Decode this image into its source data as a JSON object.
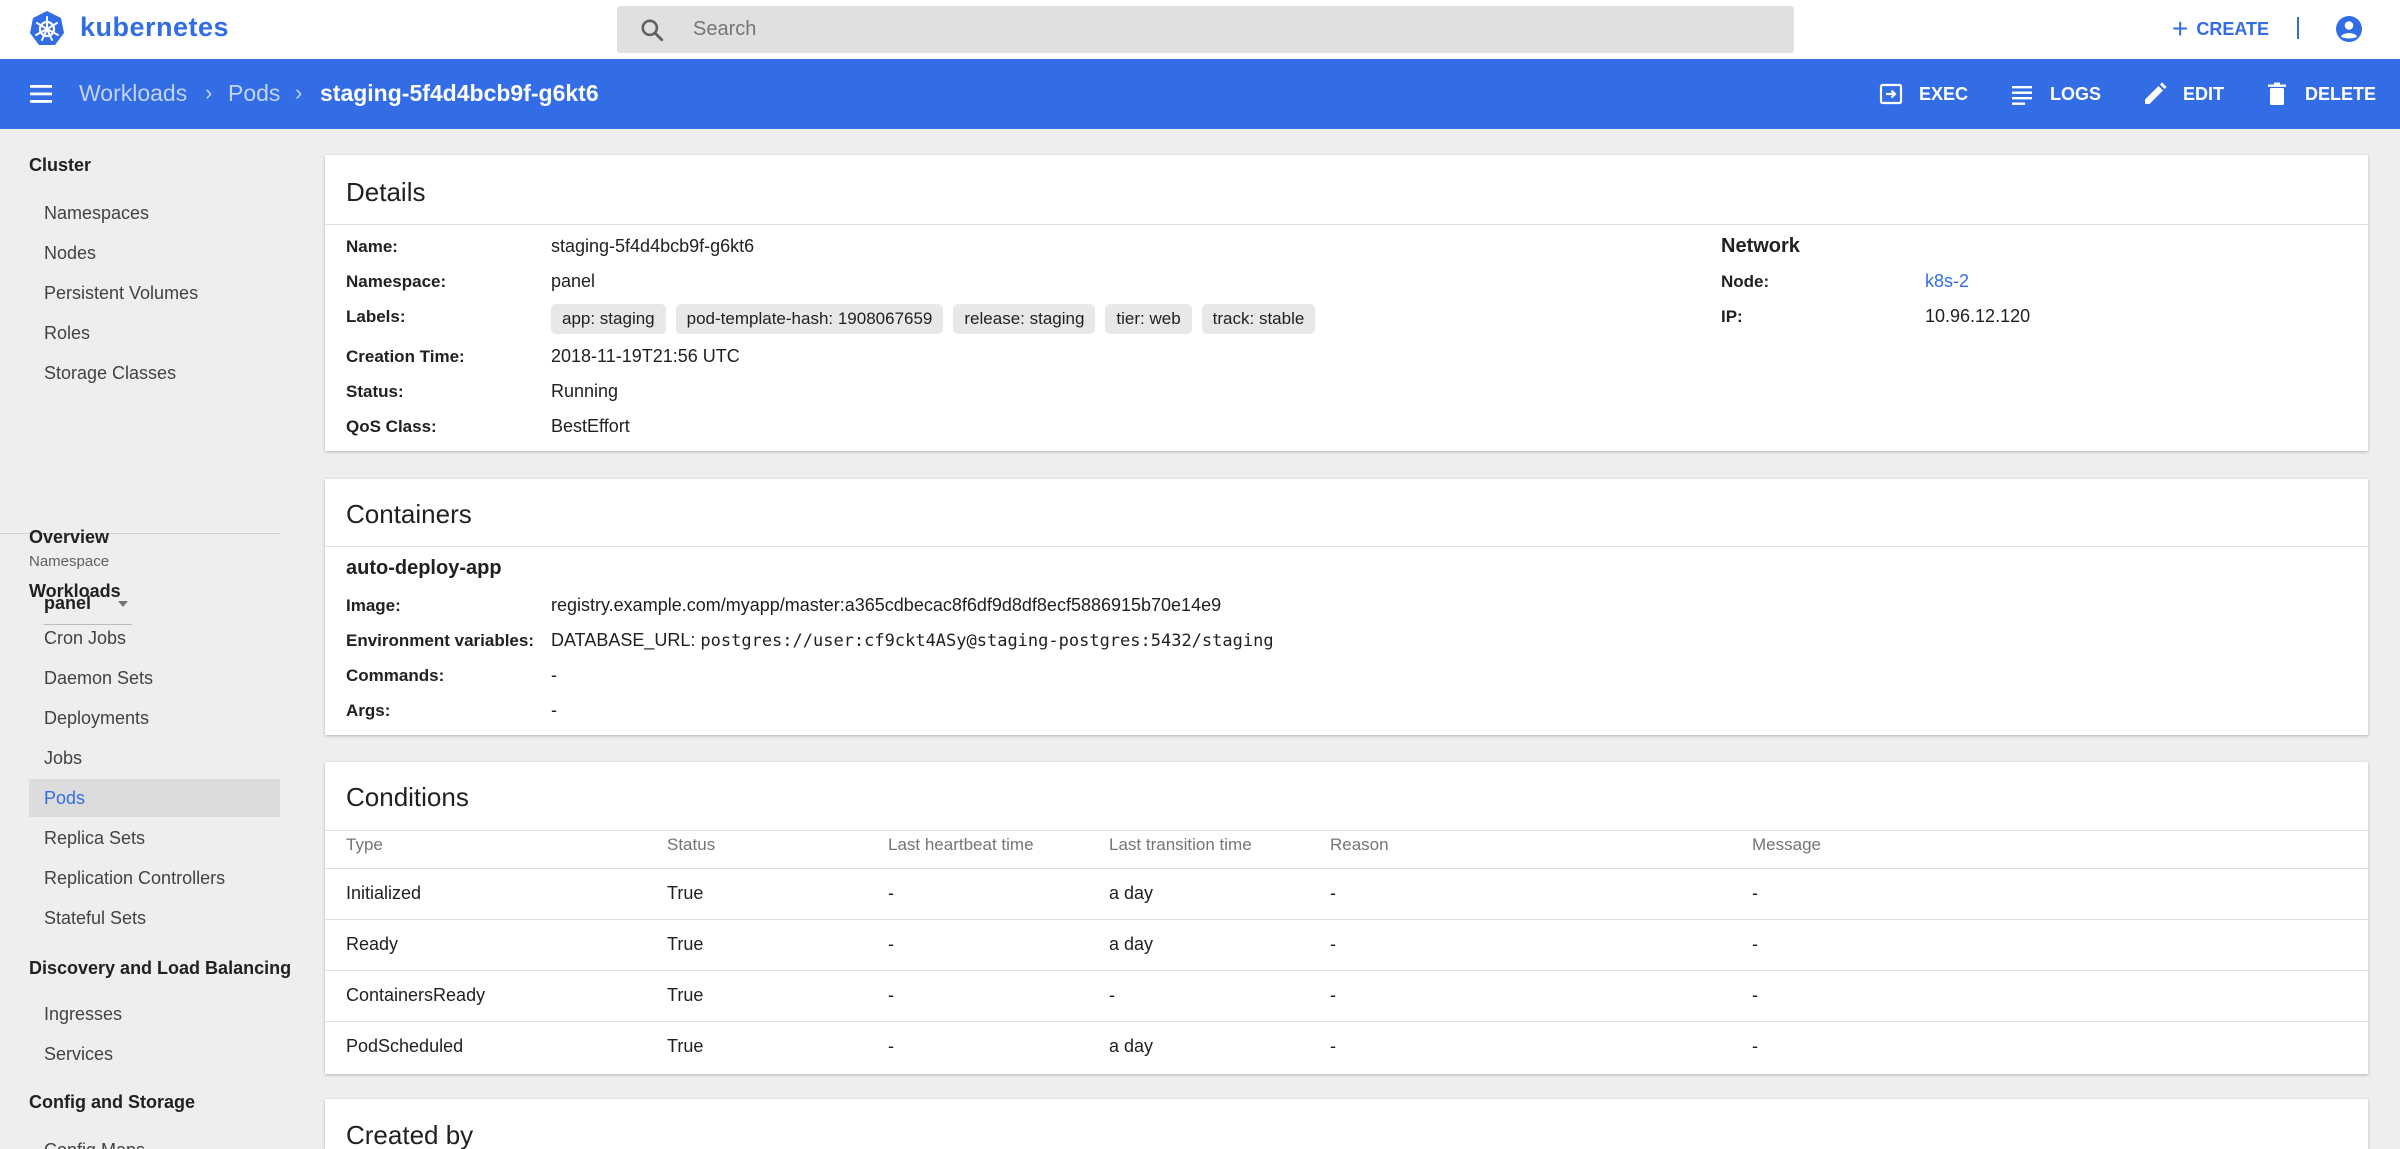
{
  "brand": {
    "name": "kubernetes"
  },
  "search": {
    "placeholder": "Search"
  },
  "topbar": {
    "create_label": "CREATE"
  },
  "breadcrumb": {
    "items": [
      "Workloads",
      "Pods"
    ],
    "current": "staging-5f4d4bcb9f-g6kt6"
  },
  "actions": {
    "exec": "EXEC",
    "logs": "LOGS",
    "edit": "EDIT",
    "delete": "DELETE"
  },
  "sidebar": {
    "cluster": {
      "title": "Cluster",
      "items": [
        "Namespaces",
        "Nodes",
        "Persistent Volumes",
        "Roles",
        "Storage Classes"
      ]
    },
    "namespace": {
      "label": "Namespace",
      "value": "panel"
    },
    "overview": "Overview",
    "workloads": {
      "title": "Workloads",
      "items": [
        "Cron Jobs",
        "Daemon Sets",
        "Deployments",
        "Jobs",
        "Pods",
        "Replica Sets",
        "Replication Controllers",
        "Stateful Sets"
      ],
      "active": "Pods"
    },
    "discovery": {
      "title": "Discovery and Load Balancing",
      "items": [
        "Ingresses",
        "Services"
      ]
    },
    "config": {
      "title": "Config and Storage",
      "items": [
        "Config Maps"
      ]
    }
  },
  "details": {
    "title": "Details",
    "name_key": "Name:",
    "name": "staging-5f4d4bcb9f-g6kt6",
    "namespace_key": "Namespace:",
    "namespace": "panel",
    "labels_key": "Labels:",
    "labels": [
      "app: staging",
      "pod-template-hash: 1908067659",
      "release: staging",
      "tier: web",
      "track: stable"
    ],
    "creation_key": "Creation Time:",
    "creation_time": "2018-11-19T21:56 UTC",
    "status_key": "Status:",
    "status": "Running",
    "qos_key": "QoS Class:",
    "qos_class": "BestEffort",
    "network": {
      "title": "Network",
      "node_key": "Node:",
      "node": "k8s-2",
      "ip_key": "IP:",
      "ip": "10.96.12.120"
    }
  },
  "containers": {
    "title": "Containers",
    "name": "auto-deploy-app",
    "image_key": "Image:",
    "image": "registry.example.com/myapp/master:a365cdbecac8f6df9d8df8ecf5886915b70e14e9",
    "env_key": "Environment variables:",
    "env_name": "DATABASE_URL:",
    "env_value": "postgres://user:cf9ckt4ASy@staging-postgres:5432/staging",
    "commands_key": "Commands:",
    "commands": "-",
    "args_key": "Args:",
    "args": "-"
  },
  "conditions": {
    "title": "Conditions",
    "columns": [
      "Type",
      "Status",
      "Last heartbeat time",
      "Last transition time",
      "Reason",
      "Message"
    ],
    "rows": [
      [
        "Initialized",
        "True",
        "-",
        "a day",
        "-",
        "-"
      ],
      [
        "Ready",
        "True",
        "-",
        "a day",
        "-",
        "-"
      ],
      [
        "ContainersReady",
        "True",
        "-",
        "-",
        "-",
        "-"
      ],
      [
        "PodScheduled",
        "True",
        "-",
        "a day",
        "-",
        "-"
      ]
    ]
  },
  "created_by": {
    "title": "Created by"
  },
  "colors": {
    "primary": "#326de6",
    "background": "#eeeeee",
    "card": "#ffffff"
  },
  "icons": [
    "kubernetes-logo-icon",
    "search-icon",
    "plus-icon",
    "account-circle-icon",
    "menu-icon",
    "chevron-right-icon",
    "exec-icon",
    "logs-icon",
    "edit-pencil-icon",
    "delete-trash-icon",
    "dropdown-caret-icon"
  ]
}
